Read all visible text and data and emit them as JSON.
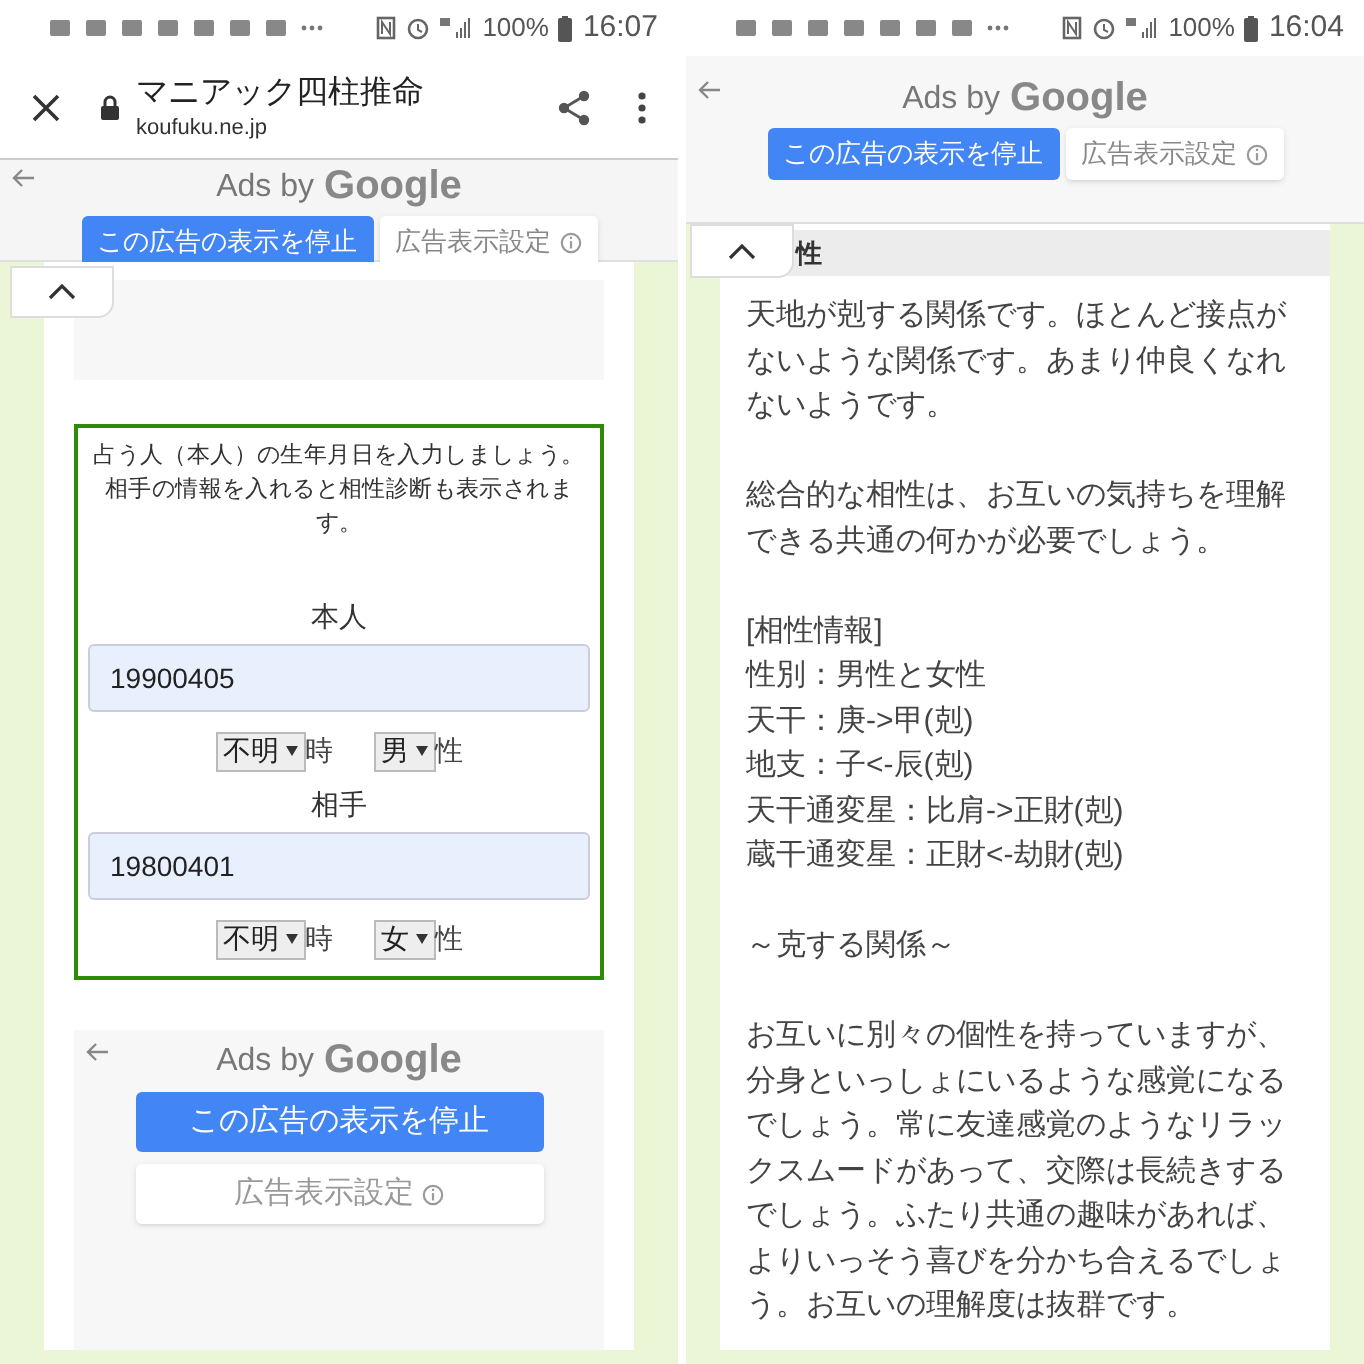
{
  "left_screen": {
    "status_bar": {
      "battery": "100%",
      "time": "16:07"
    },
    "browser_bar": {
      "title": "マニアック四柱推命",
      "url": "koufuku.ne.jp"
    },
    "top_ad": {
      "ads_label": "Ads by",
      "ads_brand": "Google",
      "stop_button": "この広告の表示を停止",
      "settings_button": "広告表示設定",
      "kind": "row"
    },
    "form": {
      "intro": "占う人（本人）の生年月日を入力しましょう。相手の情報を入れると相性診断も表示されます。",
      "people": [
        {
          "label": "本人",
          "birthdate": "19900405",
          "hour": "不明",
          "hour_suffix": "時",
          "gender": "男",
          "gender_suffix": "性"
        },
        {
          "label": "相手",
          "birthdate": "19800401",
          "hour": "不明",
          "hour_suffix": "時",
          "gender": "女",
          "gender_suffix": "性"
        }
      ]
    },
    "bottom_ad": {
      "ads_label": "Ads by",
      "ads_brand": "Google",
      "stop_button": "この広告の表示を停止",
      "settings_button": "広告表示設定",
      "kind": "stacked"
    }
  },
  "right_screen": {
    "status_bar": {
      "battery": "100%",
      "time": "16:04"
    },
    "top_ad": {
      "ads_label": "Ads by",
      "ads_brand": "Google",
      "stop_button": "この広告の表示を停止",
      "settings_button": "広告表示設定",
      "kind": "row"
    },
    "section_heading": "性",
    "blocks": [
      [
        "天地が剋する関係です。ほとんど接点がないような関係です。あまり仲良くなれないようです。"
      ],
      [
        "総合的な相性は、お互いの気持ちを理解できる共通の何かが必要でしょう。"
      ],
      [
        "[相性情報]",
        "性別：男性と女性",
        "天干：庚->甲(剋)",
        "地支：子<-辰(剋)",
        "天干通変星：比肩->正財(剋)",
        "蔵干通変星：正財<-劫財(剋)"
      ],
      [
        "～克する関係～"
      ],
      [
        "お互いに別々の個性を持っていますが、分身といっしょにいるような感覚になるでしょう。常に友達感覚のようなリラックスムードがあって、交際は長続きするでしょう。ふたり共通の趣味があれば、よりいっそう喜びを分かち合えるでしょう。お互いの理解度は抜群です。"
      ]
    ]
  }
}
